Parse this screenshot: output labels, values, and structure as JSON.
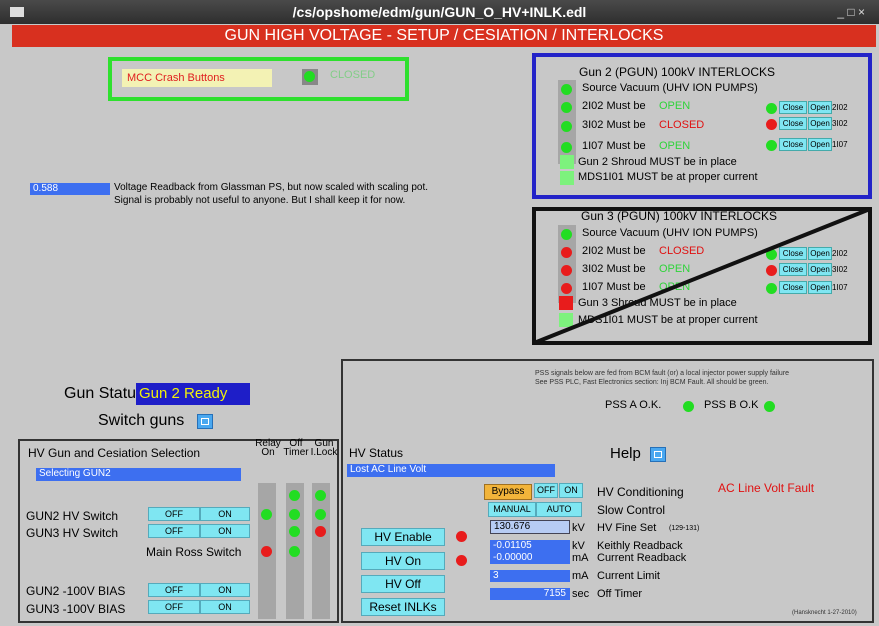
{
  "window": {
    "title": "/cs/opshome/edm/gun/GUN_O_HV+INLK.edl",
    "controls": "_ □ ×"
  },
  "header": "GUN HIGH VOLTAGE   -   SETUP  /  CESIATION  /  INTERLOCKS",
  "mcc": {
    "label": "MCC Crash Buttons",
    "status": "CLOSED"
  },
  "voltage": {
    "value": "0.588",
    "line1": "Voltage Readback from Glassman PS, but now scaled with scaling pot.",
    "line2": "Signal is probably not useful to anyone. But I shall keep it for now."
  },
  "gun2": {
    "title": "Gun 2 (PGUN) 100kV INTERLOCKS",
    "source": "Source Vacuum (UHV ION PUMPS)",
    "rows": [
      {
        "label": "2I02 Must be",
        "state": "OPEN",
        "tag": "2I02"
      },
      {
        "label": "3I02 Must be",
        "state": "CLOSED",
        "tag": "3I02"
      },
      {
        "label": "1I07 Must be",
        "state": "OPEN",
        "tag": "1I07"
      }
    ],
    "shroud": "Gun 2 Shroud MUST be in place",
    "mds": "MDS1I01 MUST be at proper current"
  },
  "gun3": {
    "title": "Gun 3 (PGUN) 100kV INTERLOCKS",
    "source": "Source Vacuum (UHV ION PUMPS)",
    "rows": [
      {
        "label": "2I02 Must be",
        "state": "CLOSED",
        "tag": "2I02"
      },
      {
        "label": "3I02 Must be",
        "state": "OPEN",
        "tag": "3I02"
      },
      {
        "label": "1I07 Must be",
        "state": "OPEN",
        "tag": "1I07"
      }
    ],
    "shroud": "Gun 3 Shroud MUST be in place",
    "mds": "MDS1I01 MUST be at proper current"
  },
  "valve": {
    "close": "Close",
    "open": "Open"
  },
  "status": {
    "label": "Gun Status",
    "value": "Gun 2 Ready",
    "switch": "Switch guns"
  },
  "pss": {
    "line1": "PSS signals below are fed from BCM fault (or) a local injector power supply failure",
    "line2": "See PSS PLC, Fast Electronics section: Inj BCM Fault.  All should be green.",
    "a": "PSS A O.K.",
    "b": "PSS B O.K"
  },
  "selection": {
    "title": "HV Gun and Cesiation Selection",
    "field": "Selecting GUN2",
    "col_relay": "Relay On",
    "col_off": "Off Timer",
    "col_gun": "Gun I.Lock",
    "gun2_hv": "GUN2 HV Switch",
    "gun3_hv": "GUN3 HV Switch",
    "ross": "Main Ross Switch",
    "gun2_bias": "GUN2 -100V BIAS",
    "gun3_bias": "GUN3 -100V BIAS",
    "off": "OFF",
    "on": "ON"
  },
  "hv": {
    "title": "HV Status",
    "status": "Lost AC Line Volt",
    "help": "Help",
    "bypass": "Bypass",
    "off": "OFF",
    "on": "ON",
    "manual": "MANUAL",
    "auto": "AUTO",
    "conditioning": "HV Conditioning",
    "fault": "AC Line Volt Fault",
    "slow": "Slow Control",
    "enable": "HV Enable",
    "hvon": "HV On",
    "hvoff": "HV Off",
    "reset": "Reset INLKs",
    "fine_val": "130.676",
    "fine_unit": "kV",
    "fine_label": "HV Fine Set",
    "fine_range": "(129-131)",
    "keithly_val": "-0.01105",
    "keithly_unit": "kV",
    "keithly_label": "Keithly Readback",
    "current_val": "-0.00000",
    "current_unit": "mA",
    "current_label": "Current Readback",
    "limit_val": "3",
    "limit_unit": "mA",
    "limit_label": "Current Limit",
    "timer_val": "7155",
    "timer_unit": "sec",
    "timer_label": "Off Timer",
    "credit": "(Hansknecht 1-27-2010)"
  }
}
